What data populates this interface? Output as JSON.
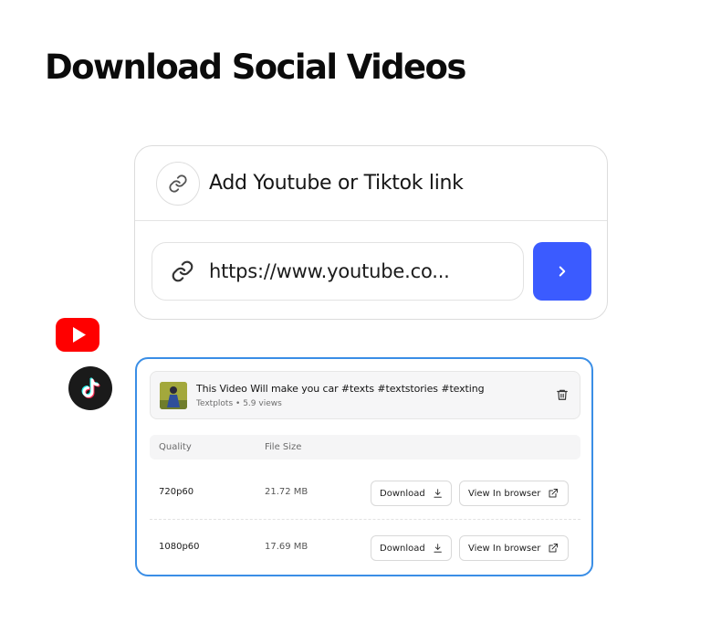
{
  "page": {
    "title": "Download Social Videos"
  },
  "link_card": {
    "header_label": "Add Youtube or Tiktok link",
    "url_value": "https://www.youtube.co...",
    "accent": "#3b5bff"
  },
  "brands": {
    "youtube_color": "#ff0000",
    "tiktok_bg": "#1a1a1a"
  },
  "result": {
    "video_title": "This Video Will make you car #texts #textstories #texting",
    "channel": "Textplots",
    "views": "5.9 views",
    "table": {
      "headers": [
        "Quality",
        "File Size"
      ],
      "rows": [
        {
          "quality": "720p60",
          "size": "21.72 MB"
        },
        {
          "quality": "1080p60",
          "size": "17.69 MB"
        }
      ],
      "download_label": "Download",
      "view_label": "View In browser"
    },
    "border_color": "#3a8ee6"
  }
}
